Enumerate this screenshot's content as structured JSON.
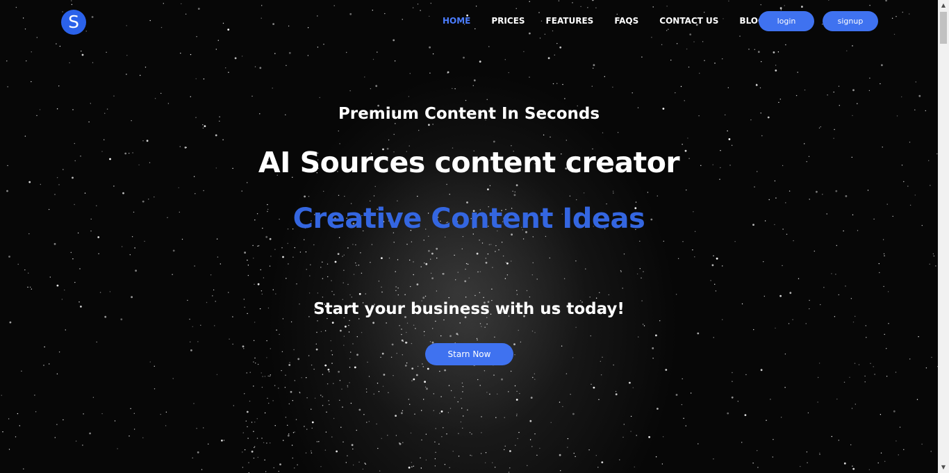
{
  "brand": {
    "logo_letter": "S",
    "logo_color": "#2b62ea"
  },
  "nav": {
    "items": [
      {
        "label": "HOME",
        "active": true
      },
      {
        "label": "PRICES",
        "active": false
      },
      {
        "label": "FEATURES",
        "active": false
      },
      {
        "label": "FAQS",
        "active": false
      },
      {
        "label": "CONTACT US",
        "active": false
      },
      {
        "label": "BLOGS",
        "active": false
      }
    ],
    "active_color": "#4b7dff",
    "login_label": "login",
    "signup_label": "signup"
  },
  "hero": {
    "tagline": "Premium Content In Seconds",
    "headline": "AI Sources content creator",
    "highlight": "Creative Content Ideas",
    "highlight_color": "#3466e0",
    "subline": "Start your business with us today!",
    "cta_label": "Starn Now",
    "button_color": "#3f72f0"
  },
  "background": {
    "theme": "starfield",
    "base_color": "#070707"
  }
}
